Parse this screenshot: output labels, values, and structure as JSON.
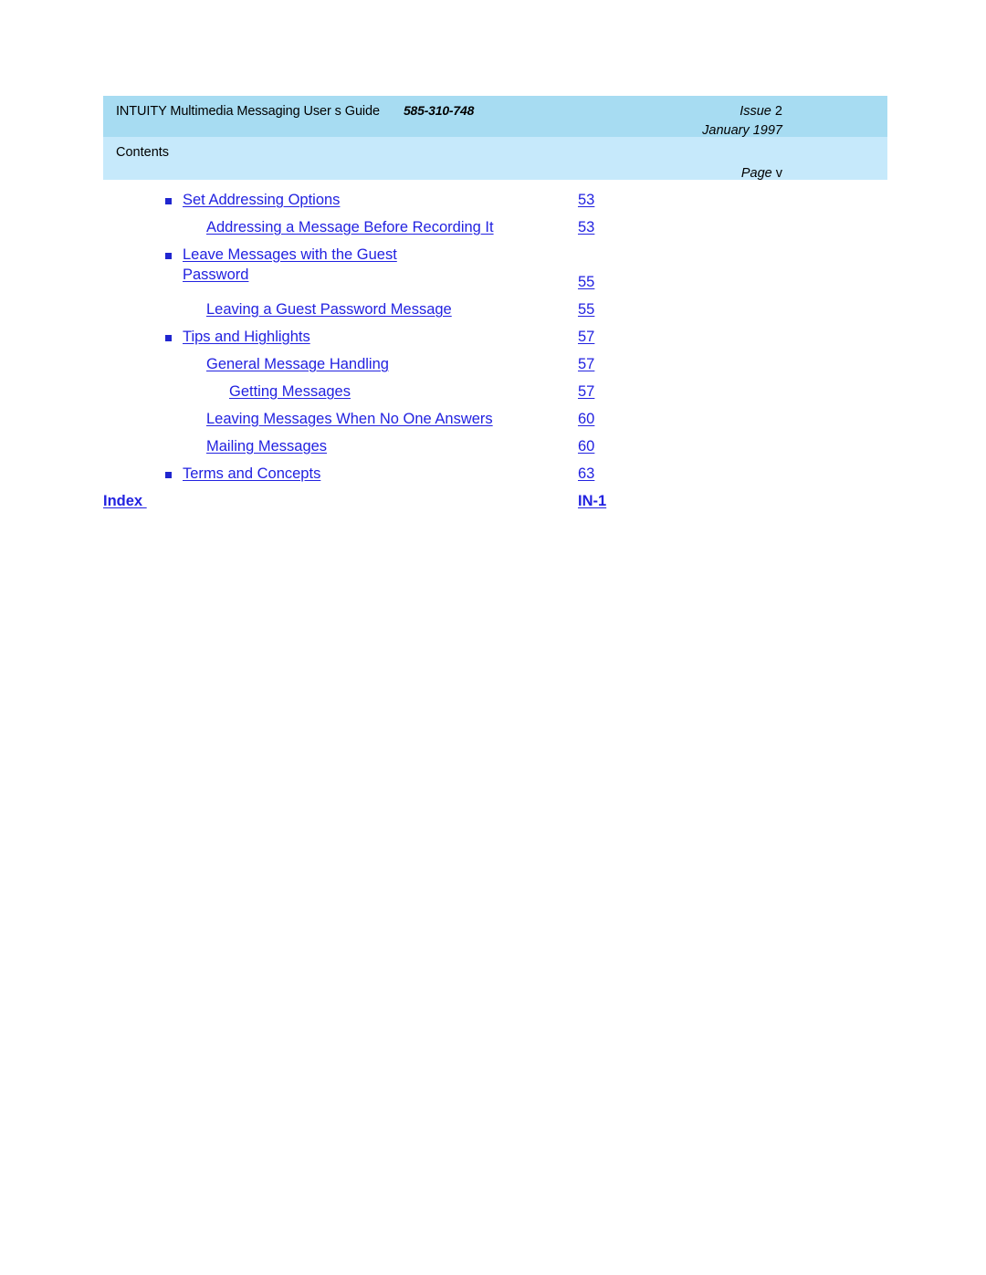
{
  "header": {
    "doc_title": "INTUITY Multimedia Messaging User s Guide",
    "doc_number": "585-310-748",
    "issue_word": "Issue",
    "issue_value": "2",
    "date": "January 1997",
    "section_label": "Contents",
    "page_word": "Page",
    "page_value": "v",
    "band_top_color": "#a7dcf2",
    "band_bottom_color": "#c6e9fb"
  },
  "toc": {
    "link_color": "#2222e0",
    "bullet_color": "#2026cf",
    "entries": [
      {
        "label": "Set Addressing Options",
        "page": "53",
        "level": 1,
        "bullet": true,
        "lines": 1
      },
      {
        "label": "Addressing a Message Before Recording It",
        "page": "53",
        "level": 2,
        "bullet": false,
        "lines": 1
      },
      {
        "label": "Leave Messages with the Guest\nPassword",
        "page": "55",
        "level": 1,
        "bullet": true,
        "lines": 2
      },
      {
        "label": "Leaving a Guest Password Message",
        "page": "55",
        "level": 2,
        "bullet": false,
        "lines": 1
      },
      {
        "label": "Tips and Highlights",
        "page": "57",
        "level": 1,
        "bullet": true,
        "lines": 1
      },
      {
        "label": "General Message Handling",
        "page": "57",
        "level": 2,
        "bullet": false,
        "lines": 1
      },
      {
        "label": "Getting Messages",
        "page": "57",
        "level": 3,
        "bullet": false,
        "lines": 1
      },
      {
        "label": "Leaving Messages When No One Answers",
        "page": "60",
        "level": 2,
        "bullet": false,
        "lines": 1
      },
      {
        "label": "Mailing Messages",
        "page": "60",
        "level": 2,
        "bullet": false,
        "lines": 1
      },
      {
        "label": "Terms and Concepts",
        "page": "63",
        "level": 1,
        "bullet": true,
        "lines": 1
      },
      {
        "label": "Index ",
        "page": "IN-1",
        "level": 0,
        "bullet": false,
        "lines": 1
      }
    ]
  }
}
